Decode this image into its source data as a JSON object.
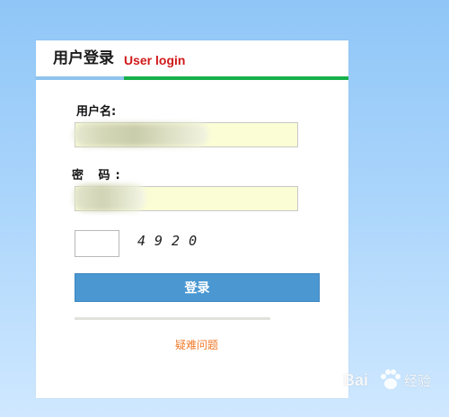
{
  "header": {
    "title": "用户登录",
    "subtitle": "User login"
  },
  "form": {
    "username_label": "用户名:",
    "password_label": "密 码:",
    "username_value": "",
    "password_value": "",
    "captcha_value": "",
    "captcha_code": "4920",
    "login_label": "登录",
    "help_link": "疑难问题"
  },
  "watermark": {
    "logo_text": "Bai",
    "suffix": "经验"
  },
  "colors": {
    "background": "#a9d4fb",
    "header_title": "#1a1a1a",
    "header_subtitle": "#d11a1a",
    "bar_left": "#8fc4ee",
    "bar_right": "#16b04a",
    "input_bg": "#fbfdd5",
    "login_button": "#4a97d2",
    "help_link": "#f07a2b"
  }
}
